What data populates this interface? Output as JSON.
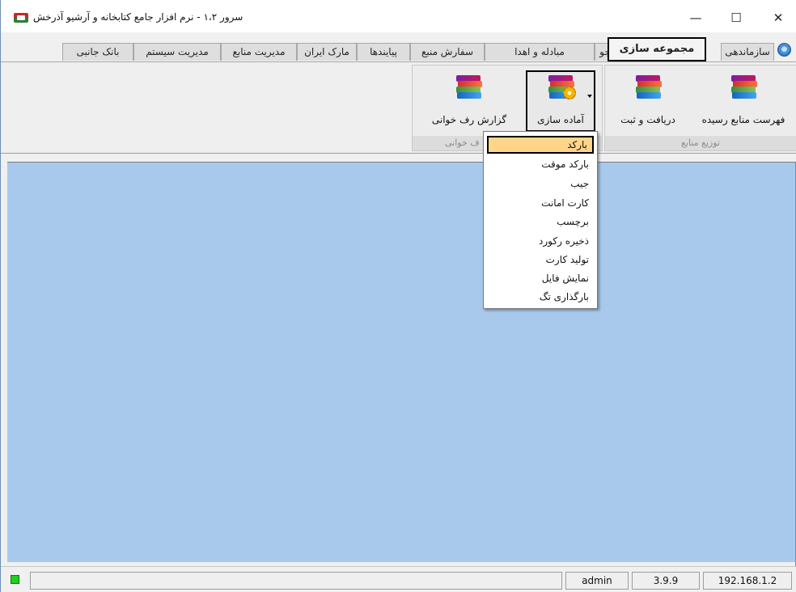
{
  "window": {
    "title": "سرور ۱،۲ - نرم افزار جامع کتابخانه و آرشیو آذرخش",
    "controls": {
      "minimize": "—",
      "maximize": "☐",
      "close": "✕"
    }
  },
  "tabs": [
    {
      "label": "سازماندهی",
      "active": false
    },
    {
      "label": "مجموعه سازی",
      "active": true
    },
    {
      "label": "جستجو",
      "active": false
    },
    {
      "label": "مبادله و اهدا",
      "active": false
    },
    {
      "label": "سفارش منبع",
      "active": false
    },
    {
      "label": "پیایندها",
      "active": false
    },
    {
      "label": "مارک ایران",
      "active": false
    },
    {
      "label": "مدیریت منابع",
      "active": false
    },
    {
      "label": "مدیریت سیستم",
      "active": false
    },
    {
      "label": "بانک جانبی",
      "active": false
    }
  ],
  "ribbon": {
    "groups": [
      {
        "caption": "توزیع منابع",
        "buttons": [
          {
            "label": "فهرست منابع رسیده",
            "icon": "books-icon"
          },
          {
            "label": "دریافت و ثبت",
            "icon": "books-icon"
          }
        ]
      },
      {
        "caption": "ف خوانی",
        "buttons": [
          {
            "label": "آماده سازی",
            "icon": "books-gear-icon",
            "has_dropdown": true
          },
          {
            "label": "گزارش رف خوانی",
            "icon": "books-icon"
          }
        ]
      }
    ]
  },
  "menu": {
    "items": [
      {
        "label": "بارکد",
        "highlighted": true
      },
      {
        "label": "بارکد موقت"
      },
      {
        "label": "جیب"
      },
      {
        "label": "کارت امانت"
      },
      {
        "label": "برچسب"
      },
      {
        "label": "ذخیره رکورد"
      },
      {
        "label": "تولید کارت"
      },
      {
        "label": "نمایش فایل"
      },
      {
        "label": "بارگذاری تگ"
      }
    ]
  },
  "statusbar": {
    "indicator_color": "#1fd01f",
    "user": "admin",
    "version": "3.9.9",
    "ip": "192.168.1.2"
  },
  "colors": {
    "workspace": "#a8c9ec",
    "menu_highlight": "#ffd58a"
  }
}
